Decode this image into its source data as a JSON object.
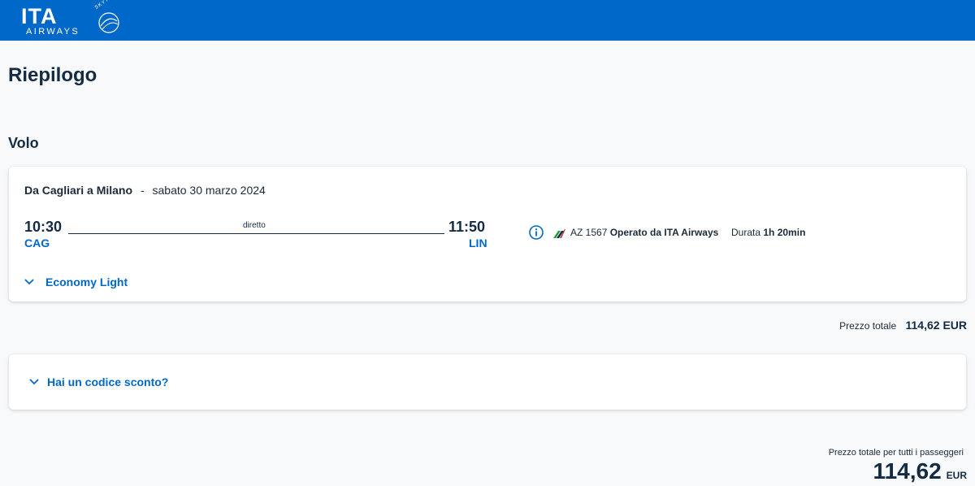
{
  "header": {
    "brand_word": "ITA",
    "brand_sub": "AIRWAYS",
    "alliance": "SKYTEAM",
    "colors": {
      "bar": "#0068c9",
      "logo": "#ffffff"
    }
  },
  "page": {
    "title": "Riepilogo",
    "section_title": "Volo"
  },
  "flight": {
    "route_label": "Da Cagliari a Milano",
    "separator": "-",
    "date": "sabato 30 marzo 2024",
    "departure": {
      "time": "10:30",
      "airport": "CAG"
    },
    "arrival": {
      "time": "11:50",
      "airport": "LIN"
    },
    "stops_label": "diretto",
    "flight_number": "AZ 1567",
    "operated_by": "Operato da ITA Airways",
    "duration_label": "Durata",
    "duration_value": "1h 20min",
    "fare_label": "Economy Light",
    "icons": {
      "info": "info-icon",
      "airline": "ita-airline-icon",
      "toggle": "chevron-down-icon"
    }
  },
  "price": {
    "label": "Prezzo totale",
    "value": "114,62 EUR"
  },
  "discount": {
    "label": "Hai un codice sconto?"
  },
  "total": {
    "label": "Prezzo totale per tutti i passeggeri",
    "amount": "114,62",
    "currency": "EUR"
  },
  "colors": {
    "accent": "#0068c9",
    "text_dark": "#142b43",
    "background": "#f8f9fa",
    "card": "#ffffff"
  }
}
